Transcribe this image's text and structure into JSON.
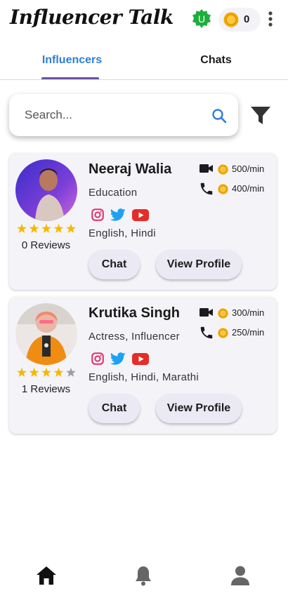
{
  "app": {
    "title": "Influencer Talk",
    "user_initial": "U",
    "coin_count": "0"
  },
  "tabs": [
    {
      "label": "Influencers",
      "active": true
    },
    {
      "label": "Chats",
      "active": false
    }
  ],
  "search": {
    "placeholder": "Search..."
  },
  "influencers": [
    {
      "name": "Neeraj Walia",
      "category": "Education",
      "languages": "English, Hindi",
      "rating": 5,
      "reviews": "0 Reviews",
      "video_rate": "500/min",
      "call_rate": "400/min",
      "socials": [
        "instagram",
        "twitter",
        "youtube"
      ],
      "chat_label": "Chat",
      "profile_label": "View Profile"
    },
    {
      "name": "Krutika Singh",
      "category": "Actress, Influencer",
      "languages": "English, Hindi, Marathi",
      "rating": 4,
      "reviews": "1 Reviews",
      "video_rate": "300/min",
      "call_rate": "250/min",
      "socials": [
        "instagram",
        "twitter",
        "youtube"
      ],
      "chat_label": "Chat",
      "profile_label": "View Profile"
    }
  ],
  "bottom_nav": [
    {
      "icon": "home-icon",
      "active": true
    },
    {
      "icon": "bell-icon",
      "active": false
    },
    {
      "icon": "person-icon",
      "active": false
    }
  ],
  "colors": {
    "accent": "#2f7fd6",
    "tab_indicator": "#6b54a8",
    "star": "#f5b800",
    "star_empty": "#9e9e9e",
    "coin": "#f2a900",
    "badge_green": "#1fae3c"
  }
}
